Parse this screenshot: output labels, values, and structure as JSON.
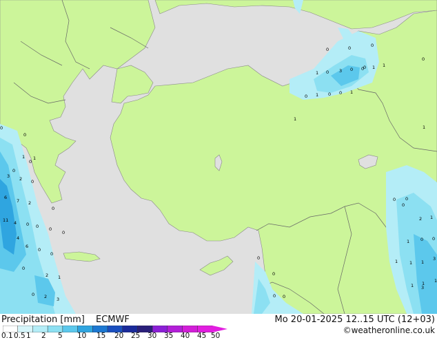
{
  "map": {
    "colors": {
      "sea": "#e0e0e0",
      "land": "#ccf59a",
      "border": "#666666",
      "coast": "#888888"
    },
    "point_values": [
      "0",
      "0",
      "0",
      "0",
      "0",
      "1",
      "1",
      "0",
      "3",
      "0",
      "0",
      "1",
      "0",
      "1",
      "0",
      "0",
      "1",
      "1",
      "0",
      "1",
      "0",
      "1",
      "1",
      "0",
      "0",
      "3",
      "2",
      "0",
      "6",
      "7",
      "2",
      "0",
      "11",
      "4",
      "0",
      "0",
      "0",
      "4",
      "6",
      "0",
      "0",
      "0",
      "2",
      "1",
      "0",
      "2",
      "3",
      "0",
      "0",
      "0",
      "0",
      "2",
      "1",
      "0",
      "1",
      "0",
      "1",
      "1",
      "1",
      "3",
      "1",
      "1",
      "3",
      "1",
      "0",
      "0",
      "0",
      "0"
    ]
  },
  "footer": {
    "title": "Precipitation [mm]",
    "model": "ECMWF",
    "datetime": "Mo 20-01-2025 12..15 UTC (12+03)",
    "credit": "©weatheronline.co.uk",
    "legend": {
      "labels": [
        "0.1",
        "0.5",
        "1",
        "2",
        "5",
        "10",
        "15",
        "20",
        "25",
        "30",
        "35",
        "40",
        "45",
        "50"
      ],
      "colors": [
        "#ffffff",
        "#d6f5fa",
        "#b4edf7",
        "#8ce0f2",
        "#5cc8ec",
        "#2fa5e0",
        "#1c78d2",
        "#1a4fbf",
        "#1a2a9a",
        "#2a1f7a",
        "#8b1fd6",
        "#b31ed8",
        "#d21ed8",
        "#e21ee0"
      ]
    }
  }
}
